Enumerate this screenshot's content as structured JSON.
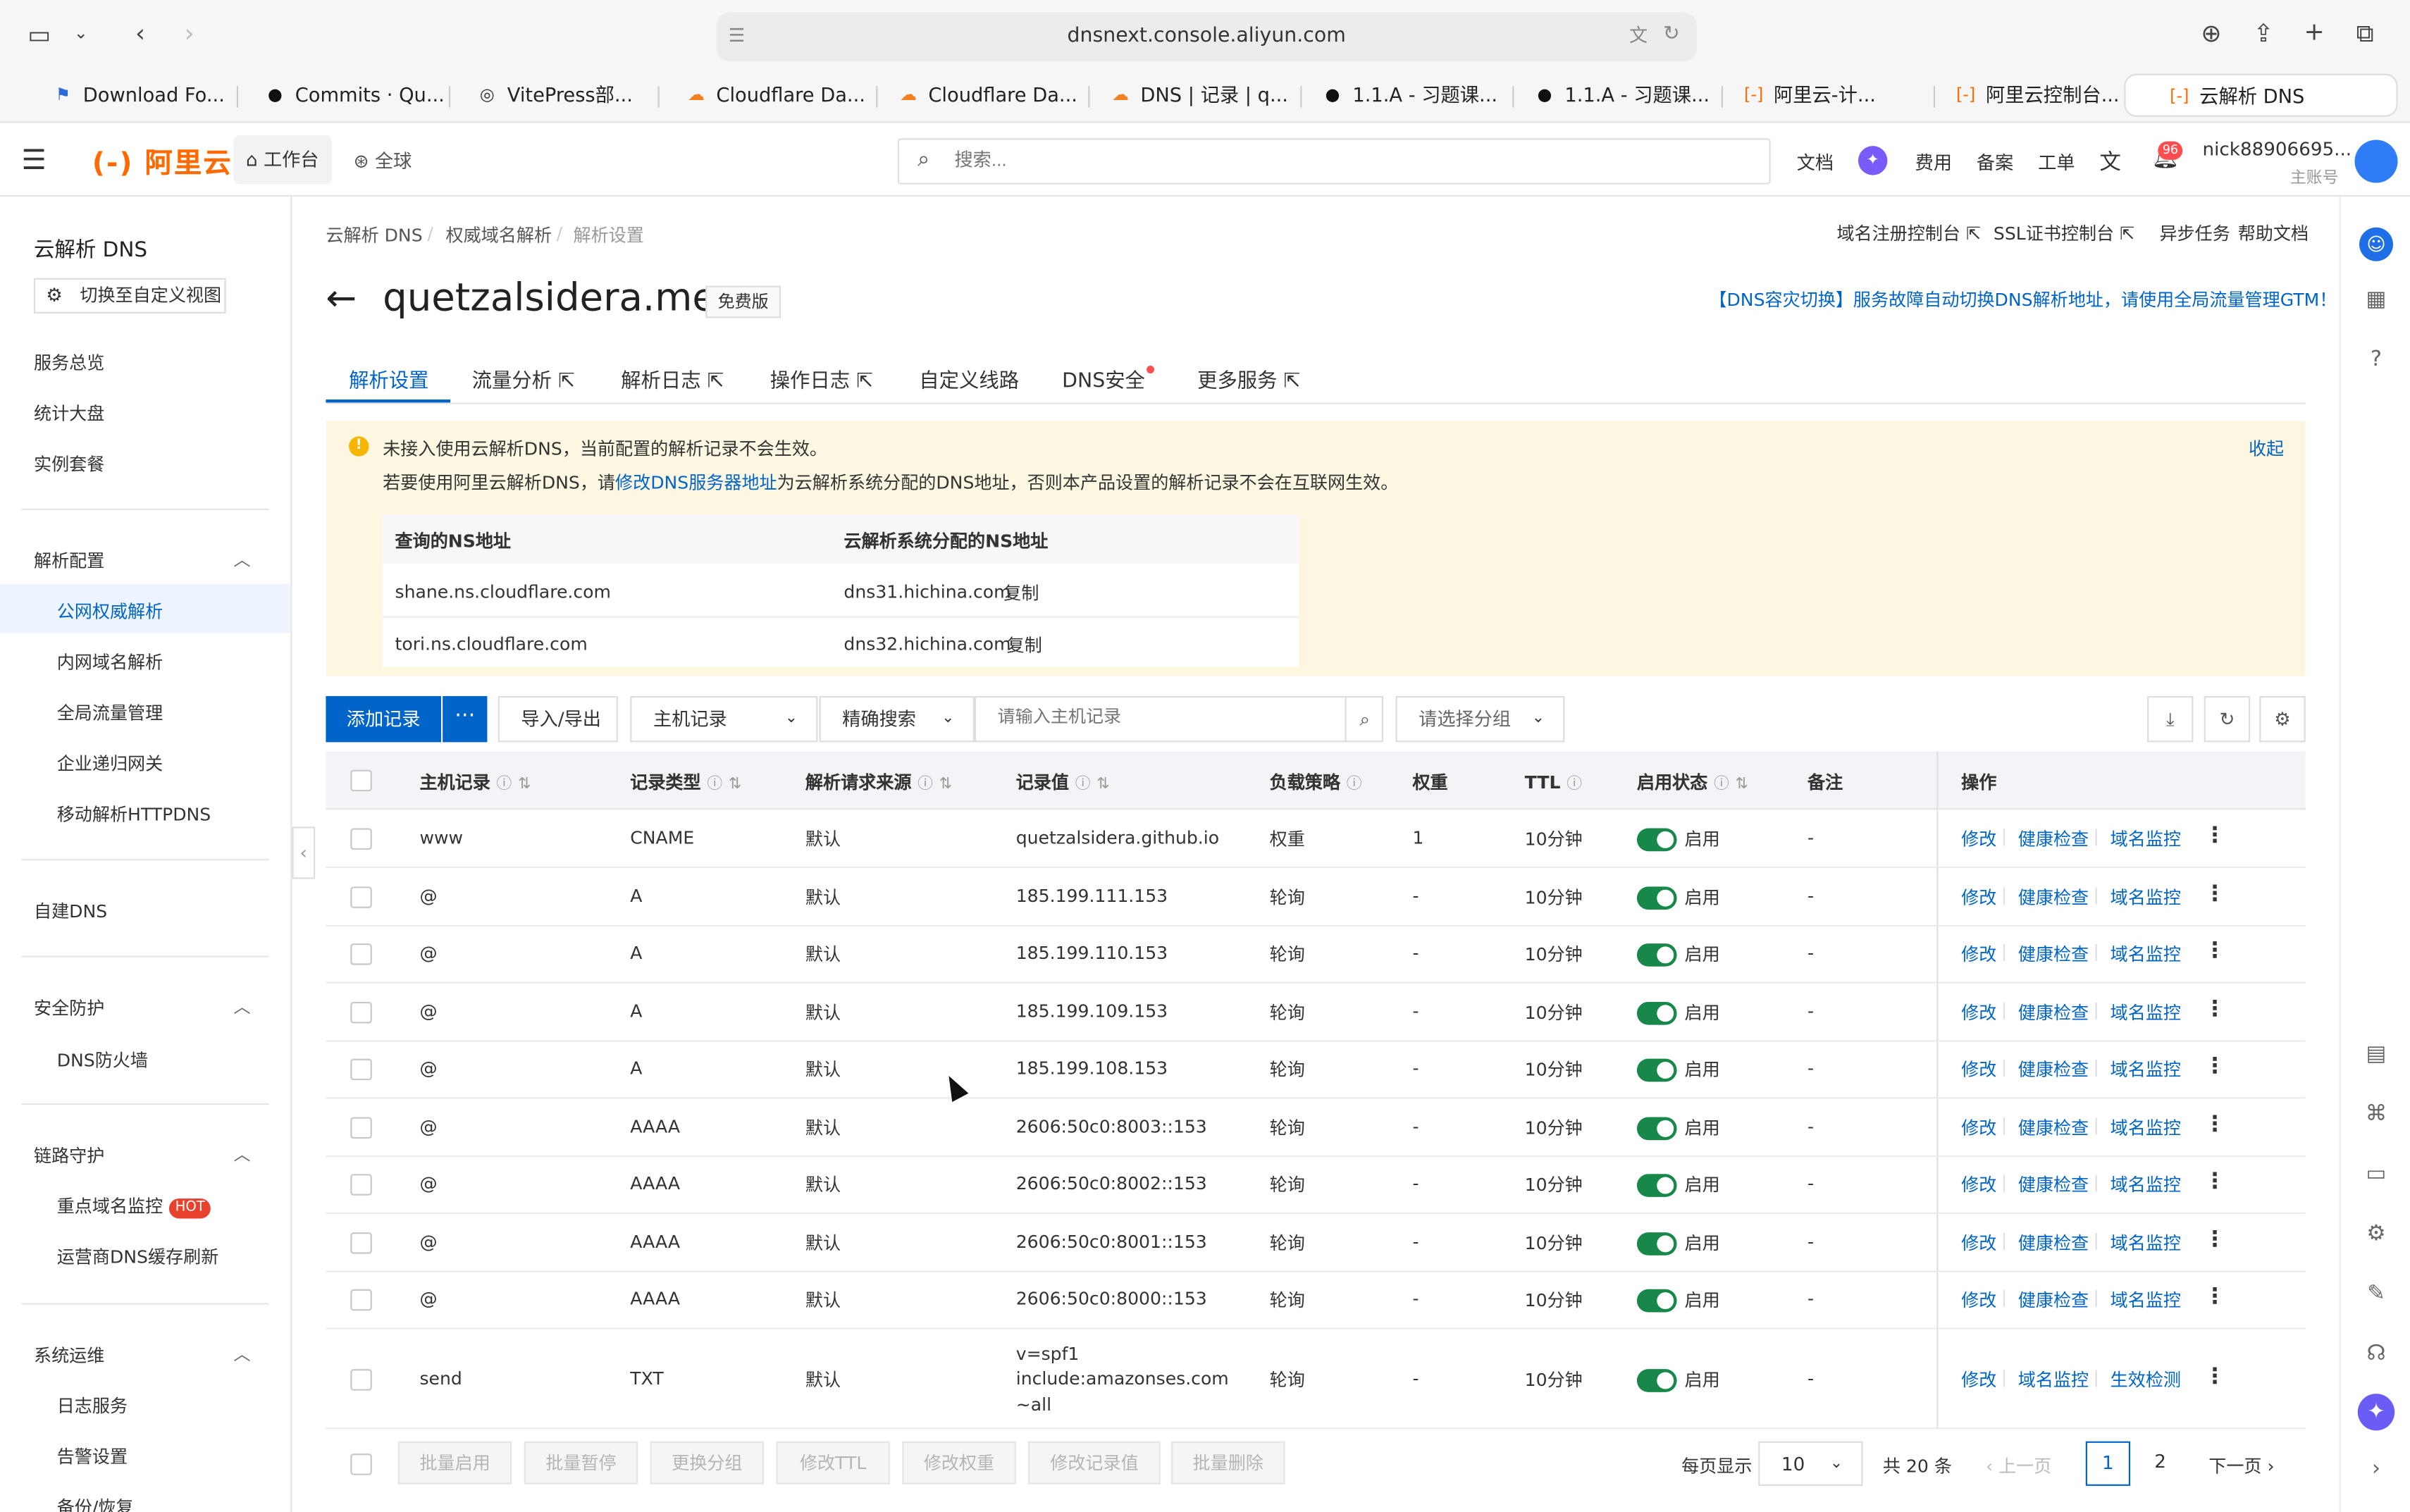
{
  "browser": {
    "url": "dnsnext.console.aliyun.com",
    "tabs": [
      {
        "label": "Download Fo...",
        "icon": "flag-icon"
      },
      {
        "label": "Commits · Qu...",
        "icon": "github-icon"
      },
      {
        "label": "VitePress部...",
        "icon": "vitepress-icon"
      },
      {
        "label": "Cloudflare Da...",
        "icon": "cloudflare-icon"
      },
      {
        "label": "Cloudflare Da...",
        "icon": "cloudflare-icon"
      },
      {
        "label": "DNS | 记录 | q...",
        "icon": "cloudflare-icon"
      },
      {
        "label": "1.1.A - 习题课...",
        "icon": "github-icon"
      },
      {
        "label": "1.1.A - 习题课...",
        "icon": "github-icon"
      },
      {
        "label": "阿里云-计...",
        "icon": "aliyun-icon"
      },
      {
        "label": "阿里云控制台...",
        "icon": "aliyun-icon"
      },
      {
        "label": "云解析 DNS",
        "icon": "aliyun-icon"
      }
    ]
  },
  "topbar": {
    "logo": "阿里云",
    "workbench": "工作台",
    "region": "全球",
    "search_placeholder": "搜索...",
    "links": [
      "文档",
      "费用",
      "备案",
      "工单"
    ],
    "notifications": "96",
    "account_name": "nick88906695...",
    "account_role": "主账号"
  },
  "sidebar": {
    "title": "云解析 DNS",
    "switch_view": "切换至自定义视图",
    "top_items": [
      "服务总览",
      "统计大盘",
      "实例套餐"
    ],
    "group_resolve": "解析配置",
    "resolve_items": [
      "公网权威解析",
      "内网域名解析",
      "全局流量管理",
      "企业递归网关",
      "移动解析HTTPDNS"
    ],
    "self_dns": "自建DNS",
    "group_security": "安全防护",
    "security_items": [
      "DNS防火墙"
    ],
    "group_link": "链路守护",
    "link_items": [
      "重点域名监控",
      "运营商DNS缓存刷新"
    ],
    "hot": "HOT",
    "group_ops": "系统运维",
    "ops_items": [
      "日志服务",
      "告警设置",
      "备份/恢复"
    ]
  },
  "breadcrumb": [
    "云解析 DNS",
    "权威域名解析",
    "解析设置"
  ],
  "top_links": [
    "域名注册控制台",
    "SSL证书控制台",
    "异步任务",
    "帮助文档"
  ],
  "page": {
    "domain": "quetzalsidera.me",
    "plan": "免费版",
    "gtm_notice": "【DNS容灾切换】服务故障自动切换DNS解析地址，请使用全局流量管理GTM！"
  },
  "tabs": [
    "解析设置",
    "流量分析",
    "解析日志",
    "操作日志",
    "自定义线路",
    "DNS安全",
    "更多服务"
  ],
  "notice": {
    "line1": "未接入使用云解析DNS，当前配置的解析记录不会生效。",
    "line2_pre": "若要使用阿里云解析DNS，请",
    "line2_link": "修改DNS服务器地址",
    "line2_post": "为云解析系统分配的DNS地址，否则本产品设置的解析记录不会在互联网生效。",
    "collapse": "收起",
    "ns_headers": [
      "查询的NS地址",
      "云解析系统分配的NS地址"
    ],
    "ns_rows": [
      {
        "queried": "shane.ns.cloudflare.com",
        "assigned": "dns31.hichina.com"
      },
      {
        "queried": "tori.ns.cloudflare.com",
        "assigned": "dns32.hichina.com"
      }
    ],
    "copy": "复制"
  },
  "toolbar": {
    "add": "添加记录",
    "more": "···",
    "import_export": "导入/导出",
    "field_select": "主机记录",
    "mode_select": "精确搜索",
    "search_placeholder": "请输入主机记录",
    "group_select": "请选择分组"
  },
  "table": {
    "headers": [
      "主机记录",
      "记录类型",
      "解析请求来源",
      "记录值",
      "负载策略",
      "权重",
      "TTL",
      "启用状态",
      "备注",
      "操作"
    ],
    "rows": [
      {
        "host": "www",
        "type": "CNAME",
        "source": "默认",
        "value": "quetzalsidera.github.io",
        "policy": "权重",
        "weight": "1",
        "ttl": "10分钟",
        "status": "启用",
        "note": "-",
        "ops": [
          "修改",
          "健康检查",
          "域名监控"
        ]
      },
      {
        "host": "@",
        "type": "A",
        "source": "默认",
        "value": "185.199.111.153",
        "policy": "轮询",
        "weight": "-",
        "ttl": "10分钟",
        "status": "启用",
        "note": "-",
        "ops": [
          "修改",
          "健康检查",
          "域名监控"
        ]
      },
      {
        "host": "@",
        "type": "A",
        "source": "默认",
        "value": "185.199.110.153",
        "policy": "轮询",
        "weight": "-",
        "ttl": "10分钟",
        "status": "启用",
        "note": "-",
        "ops": [
          "修改",
          "健康检查",
          "域名监控"
        ]
      },
      {
        "host": "@",
        "type": "A",
        "source": "默认",
        "value": "185.199.109.153",
        "policy": "轮询",
        "weight": "-",
        "ttl": "10分钟",
        "status": "启用",
        "note": "-",
        "ops": [
          "修改",
          "健康检查",
          "域名监控"
        ]
      },
      {
        "host": "@",
        "type": "A",
        "source": "默认",
        "value": "185.199.108.153",
        "policy": "轮询",
        "weight": "-",
        "ttl": "10分钟",
        "status": "启用",
        "note": "-",
        "ops": [
          "修改",
          "健康检查",
          "域名监控"
        ]
      },
      {
        "host": "@",
        "type": "AAAA",
        "source": "默认",
        "value": "2606:50c0:8003::153",
        "policy": "轮询",
        "weight": "-",
        "ttl": "10分钟",
        "status": "启用",
        "note": "-",
        "ops": [
          "修改",
          "健康检查",
          "域名监控"
        ]
      },
      {
        "host": "@",
        "type": "AAAA",
        "source": "默认",
        "value": "2606:50c0:8002::153",
        "policy": "轮询",
        "weight": "-",
        "ttl": "10分钟",
        "status": "启用",
        "note": "-",
        "ops": [
          "修改",
          "健康检查",
          "域名监控"
        ]
      },
      {
        "host": "@",
        "type": "AAAA",
        "source": "默认",
        "value": "2606:50c0:8001::153",
        "policy": "轮询",
        "weight": "-",
        "ttl": "10分钟",
        "status": "启用",
        "note": "-",
        "ops": [
          "修改",
          "健康检查",
          "域名监控"
        ]
      },
      {
        "host": "@",
        "type": "AAAA",
        "source": "默认",
        "value": "2606:50c0:8000::153",
        "policy": "轮询",
        "weight": "-",
        "ttl": "10分钟",
        "status": "启用",
        "note": "-",
        "ops": [
          "修改",
          "健康检查",
          "域名监控"
        ]
      },
      {
        "host": "send",
        "type": "TXT",
        "source": "默认",
        "value_lines": [
          "v=spf1",
          "include:amazonses.com",
          "~all"
        ],
        "policy": "轮询",
        "weight": "-",
        "ttl": "10分钟",
        "status": "启用",
        "note": "-",
        "ops": [
          "修改",
          "域名监控",
          "生效检测"
        ]
      }
    ]
  },
  "footer": {
    "bulk": [
      "批量启用",
      "批量暂停",
      "更换分组",
      "修改TTL",
      "修改权重",
      "修改记录值",
      "批量删除"
    ],
    "per_page_label": "每页显示",
    "per_page": "10",
    "total": "共 20 条",
    "prev": "上一页",
    "pages": [
      "1",
      "2"
    ],
    "current_page": "1",
    "next": "下一页"
  },
  "colors": {
    "brand": "#ff6a00",
    "primary": "#0064c8",
    "toggle_on": "#18884a",
    "notice_bg": "#fdf7e1"
  }
}
